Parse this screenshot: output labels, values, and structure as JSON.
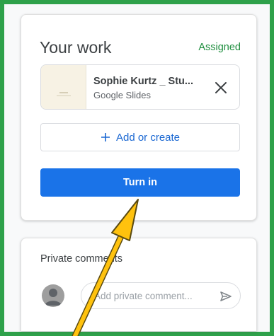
{
  "colors": {
    "frame": "#2ea14a",
    "accent": "#1a73e8",
    "status": "#1e8e3e",
    "arrow": "#ffc20e"
  },
  "work": {
    "title": "Your work",
    "status": "Assigned",
    "attachment": {
      "name": "Sophie Kurtz _ Stu...",
      "type": "Google Slides",
      "remove_icon": "close-icon"
    },
    "add_label": "Add or create",
    "turn_in_label": "Turn in"
  },
  "comments": {
    "title": "Private comments",
    "placeholder": "Add private comment...",
    "send_icon": "send-icon"
  }
}
